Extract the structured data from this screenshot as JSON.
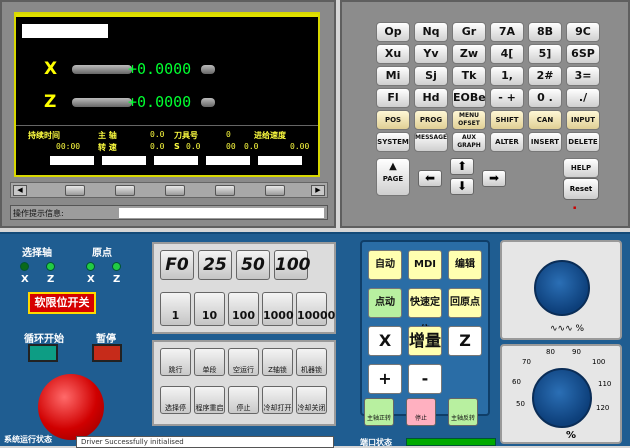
{
  "display": {
    "axes": [
      {
        "label": "X",
        "value": "+0.0000"
      },
      {
        "label": "Z",
        "value": "+0.0000"
      }
    ],
    "status": {
      "row1": [
        "持续时间",
        "主  轴",
        "0.0",
        "刀具号",
        "0",
        "进给速度"
      ],
      "row2": [
        "00:00",
        "转  速",
        "0.0",
        "S",
        "0.0",
        "00",
        "0.0",
        "0.00"
      ]
    },
    "msg_label": "操作提示信息:"
  },
  "keypad": {
    "rows": [
      [
        "Op",
        "Nq",
        "Gr",
        "7A",
        "8B",
        "9C"
      ],
      [
        "Xu",
        "Yv",
        "Zw",
        "4[",
        "5]",
        "6SP"
      ],
      [
        "Mi",
        "Sj",
        "Tk",
        "1,",
        "2#",
        "3="
      ],
      [
        "Fl",
        "Hd",
        "EOBe",
        "- +",
        "0 .",
        "./"
      ],
      [
        "POS",
        "PROG",
        "MENU OFSET",
        "SHIFT",
        "CAN",
        "INPUT"
      ],
      [
        "SYSTEM",
        "MESSAGE",
        "AUX GRAPH",
        "ALTER",
        "INSERT",
        "DELETE"
      ]
    ],
    "page_label": "PAGE",
    "help": "HELP",
    "reset": "Reset"
  },
  "lower": {
    "axis_select": "选择轴",
    "home": "原点",
    "x": "X",
    "z": "Z",
    "soft_limit": "软限位开关",
    "cycle_start": "循环开始",
    "pause": "暂停",
    "feed_buttons": [
      "F0",
      "25",
      "50",
      "100"
    ],
    "step_buttons": [
      "1",
      "10",
      "100",
      "1000",
      "10000"
    ],
    "func_row1": [
      "跳行",
      "单段",
      "空运行",
      "Z轴锁",
      "机器锁"
    ],
    "func_row2": [
      "选择停",
      "程序重启",
      "停止",
      "冷却打开",
      "冷却关闭"
    ],
    "modes": [
      "自动",
      "MDI",
      "编辑",
      "点动",
      "快速定位",
      "回原点",
      "X",
      "增量",
      "Z",
      "+",
      "-"
    ],
    "spindle_buttons": [
      "主轴正转",
      "停止",
      "主轴反转"
    ],
    "left_footer": "系统运行状态",
    "status_text": "Driver Successfully initialised",
    "right_footer": "端口状态",
    "pct": "%",
    "knob1_ticks": [
      "50",
      "60",
      "70",
      "80",
      "90",
      "100",
      "110",
      "120"
    ]
  },
  "colors": {
    "accent_yellow": "#e0e000",
    "panel_blue": "#1f5d91",
    "green": "#00ff30"
  }
}
